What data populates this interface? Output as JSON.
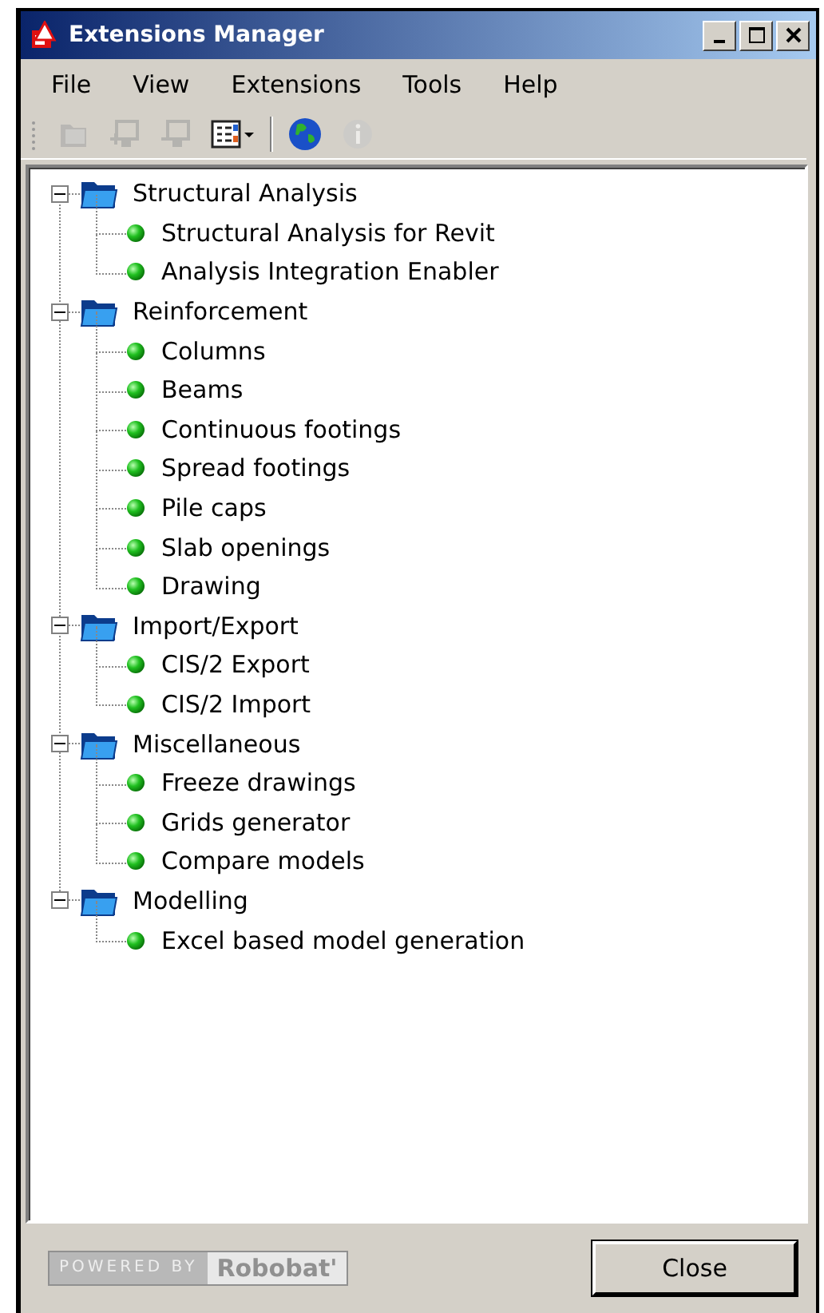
{
  "window": {
    "title": "Extensions Manager"
  },
  "menu": [
    "File",
    "View",
    "Extensions",
    "Tools",
    "Help"
  ],
  "toolbar": [
    {
      "kind": "folder",
      "disabled": true
    },
    {
      "kind": "add",
      "disabled": true
    },
    {
      "kind": "remove",
      "disabled": true
    },
    {
      "kind": "view",
      "disabled": false,
      "dropdown": true
    },
    {
      "kind": "separator"
    },
    {
      "kind": "globe",
      "disabled": false
    },
    {
      "kind": "info",
      "disabled": true
    }
  ],
  "tree": [
    {
      "label": "Structural Analysis",
      "expanded": true,
      "children": [
        {
          "label": "Structural Analysis for Revit"
        },
        {
          "label": "Analysis Integration Enabler"
        }
      ]
    },
    {
      "label": "Reinforcement",
      "expanded": true,
      "children": [
        {
          "label": "Columns"
        },
        {
          "label": "Beams"
        },
        {
          "label": "Continuous footings"
        },
        {
          "label": "Spread footings"
        },
        {
          "label": "Pile caps"
        },
        {
          "label": "Slab openings"
        },
        {
          "label": "Drawing"
        }
      ]
    },
    {
      "label": "Import/Export",
      "expanded": true,
      "children": [
        {
          "label": "CIS/2 Export"
        },
        {
          "label": "CIS/2 Import"
        }
      ]
    },
    {
      "label": "Miscellaneous",
      "expanded": true,
      "children": [
        {
          "label": "Freeze drawings"
        },
        {
          "label": "Grids generator"
        },
        {
          "label": "Compare models"
        }
      ]
    },
    {
      "label": "Modelling",
      "expanded": true,
      "children": [
        {
          "label": "Excel based model generation"
        }
      ]
    }
  ],
  "footer": {
    "powered_by": "POWERED BY",
    "brand": "Robobat'",
    "close_button": "Close"
  }
}
